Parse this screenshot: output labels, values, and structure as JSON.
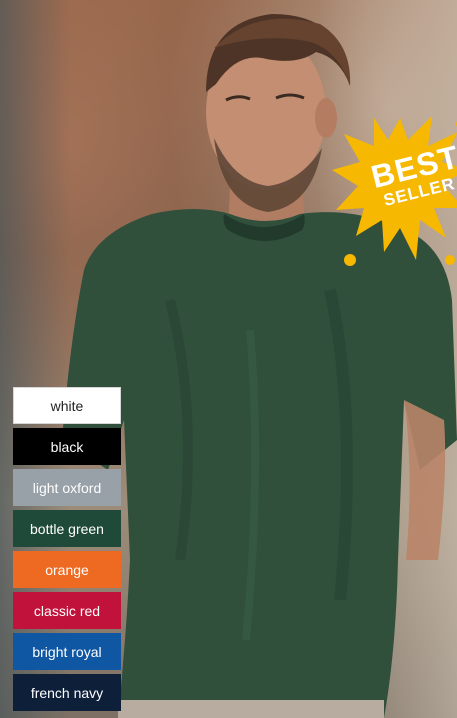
{
  "badge": {
    "line1": "BEST",
    "line2": "SELLER",
    "color": "#f6b800"
  },
  "colors": [
    {
      "label": "white",
      "hex": "#ffffff",
      "text_color": "#222222"
    },
    {
      "label": "black",
      "hex": "#000000",
      "text_color": "#ffffff"
    },
    {
      "label": "light oxford",
      "hex": "#98a1a8",
      "text_color": "#ffffff"
    },
    {
      "label": "bottle green",
      "hex": "#1f4a39",
      "text_color": "#ffffff"
    },
    {
      "label": "orange",
      "hex": "#ee6a22",
      "text_color": "#ffffff"
    },
    {
      "label": "classic red",
      "hex": "#c0123a",
      "text_color": "#ffffff"
    },
    {
      "label": "bright royal",
      "hex": "#0f56a3",
      "text_color": "#ffffff"
    },
    {
      "label": "french navy",
      "hex": "#0e1f3a",
      "text_color": "#ffffff"
    }
  ]
}
